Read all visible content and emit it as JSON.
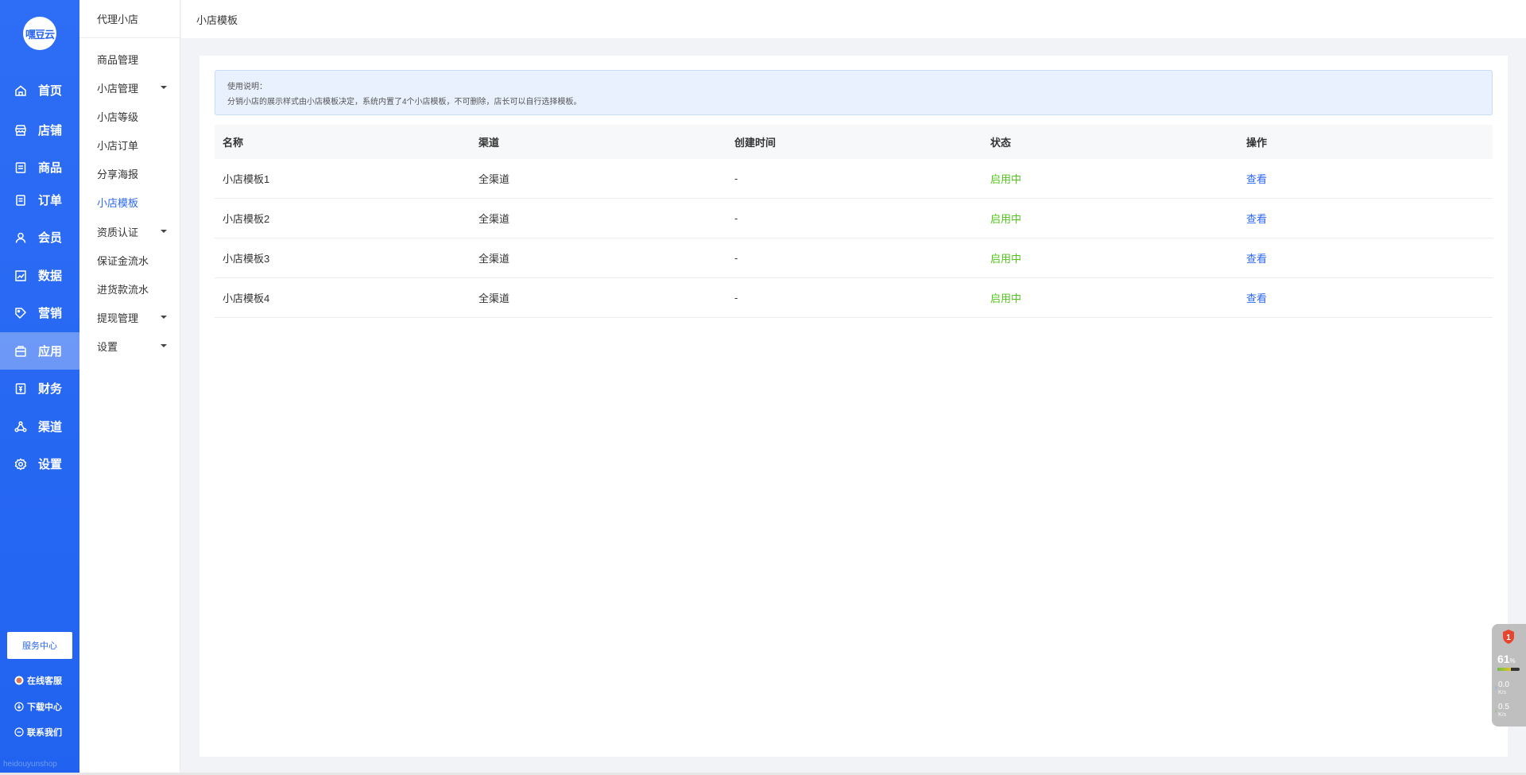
{
  "brand": {
    "logo_text": "嘿豆云",
    "watermark": "heidouyunshop"
  },
  "primary_nav": [
    {
      "label": "首页",
      "icon": "home-icon",
      "active": false
    },
    {
      "label": "店铺",
      "icon": "shop-icon",
      "active": false
    },
    {
      "label": "商品",
      "icon": "goods-icon",
      "active": false
    },
    {
      "label": "订单",
      "icon": "order-icon",
      "active": false
    },
    {
      "label": "会员",
      "icon": "user-icon",
      "active": false
    },
    {
      "label": "数据",
      "icon": "chart-icon",
      "active": false
    },
    {
      "label": "营销",
      "icon": "tag-icon",
      "active": false
    },
    {
      "label": "应用",
      "icon": "app-icon",
      "active": true
    },
    {
      "label": "财务",
      "icon": "finance-icon",
      "active": false
    },
    {
      "label": "渠道",
      "icon": "channel-icon",
      "active": false
    },
    {
      "label": "设置",
      "icon": "gear-icon",
      "active": false
    }
  ],
  "service": {
    "center_label": "服务中心",
    "online_service": "在线客服",
    "download_center": "下载中心",
    "contact_us": "联系我们"
  },
  "secondary_nav": {
    "title": "代理小店",
    "items": [
      {
        "label": "商品管理",
        "has_caret": false,
        "active": false
      },
      {
        "label": "小店管理",
        "has_caret": true,
        "active": false
      },
      {
        "label": "小店等级",
        "has_caret": false,
        "active": false
      },
      {
        "label": "小店订单",
        "has_caret": false,
        "active": false
      },
      {
        "label": "分享海报",
        "has_caret": false,
        "active": false
      },
      {
        "label": "小店模板",
        "has_caret": false,
        "active": true
      },
      {
        "label": "资质认证",
        "has_caret": true,
        "active": false
      },
      {
        "label": "保证金流水",
        "has_caret": false,
        "active": false
      },
      {
        "label": "进货款流水",
        "has_caret": false,
        "active": false
      },
      {
        "label": "提现管理",
        "has_caret": true,
        "active": false
      },
      {
        "label": "设置",
        "has_caret": true,
        "active": false
      }
    ]
  },
  "header": {
    "title": "小店模板"
  },
  "notice": {
    "heading": "使用说明：",
    "text": "分销小店的展示样式由小店模板决定，系统内置了4个小店模板，不可删除，店长可以自行选择模板。"
  },
  "table": {
    "columns": [
      "名称",
      "渠道",
      "创建时间",
      "状态",
      "操作"
    ],
    "rows": [
      {
        "name": "小店模板1",
        "channel": "全渠道",
        "created": "-",
        "status": "启用中",
        "action": "查看"
      },
      {
        "name": "小店模板2",
        "channel": "全渠道",
        "created": "-",
        "status": "启用中",
        "action": "查看"
      },
      {
        "name": "小店模板3",
        "channel": "全渠道",
        "created": "-",
        "status": "启用中",
        "action": "查看"
      },
      {
        "name": "小店模板4",
        "channel": "全渠道",
        "created": "-",
        "status": "启用中",
        "action": "查看"
      }
    ]
  },
  "widget": {
    "badge": "1",
    "percent": "61",
    "percent_unit": "%",
    "usage_fraction": 0.61,
    "up_speed": "0.0",
    "down_speed": "0.5",
    "speed_unit": "K/s"
  },
  "colors": {
    "primary": "#2b67f2",
    "status_on": "#52c41a"
  }
}
